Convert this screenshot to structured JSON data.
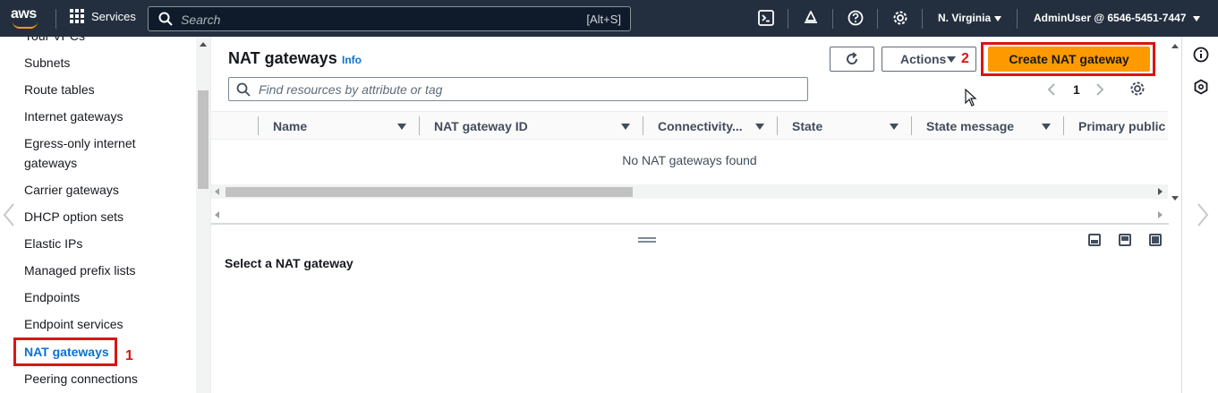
{
  "topnav": {
    "logo": "aws",
    "services_label": "Services",
    "search_placeholder": "Search",
    "search_shortcut": "[Alt+S]",
    "region": "N. Virginia",
    "account": "AdminUser @ 6546-5451-7447",
    "icons": [
      "cloudshell-icon",
      "notifications-icon",
      "help-icon",
      "settings-icon"
    ]
  },
  "sidebar": {
    "items": [
      {
        "label": "Your VPCs"
      },
      {
        "label": "Subnets"
      },
      {
        "label": "Route tables"
      },
      {
        "label": "Internet gateways"
      },
      {
        "label": "Egress-only internet"
      },
      {
        "label": "gateways"
      },
      {
        "label": "Carrier gateways"
      },
      {
        "label": "DHCP option sets"
      },
      {
        "label": "Elastic IPs"
      },
      {
        "label": "Managed prefix lists"
      },
      {
        "label": "Endpoints"
      },
      {
        "label": "Endpoint services"
      },
      {
        "label": "NAT gateways"
      },
      {
        "label": "Peering connections"
      }
    ],
    "active": "NAT gateways"
  },
  "annotations": {
    "step1": "1",
    "step2": "2",
    "color": "#d91515"
  },
  "main": {
    "title": "NAT gateways",
    "info": "Info",
    "actions_label": "Actions",
    "create_label": "Create NAT gateway",
    "filter_placeholder": "Find resources by attribute or tag",
    "page_number": "1",
    "columns": [
      "Name",
      "NAT gateway ID",
      "Connectivity...",
      "State",
      "State message",
      "Primary public"
    ],
    "empty_message": "No NAT gateways found",
    "detail_title": "Select a NAT gateway"
  },
  "colors": {
    "nav_bg": "#232f3e",
    "primary_button": "#ff9900",
    "link": "#0972d3",
    "annotation": "#d91515"
  }
}
